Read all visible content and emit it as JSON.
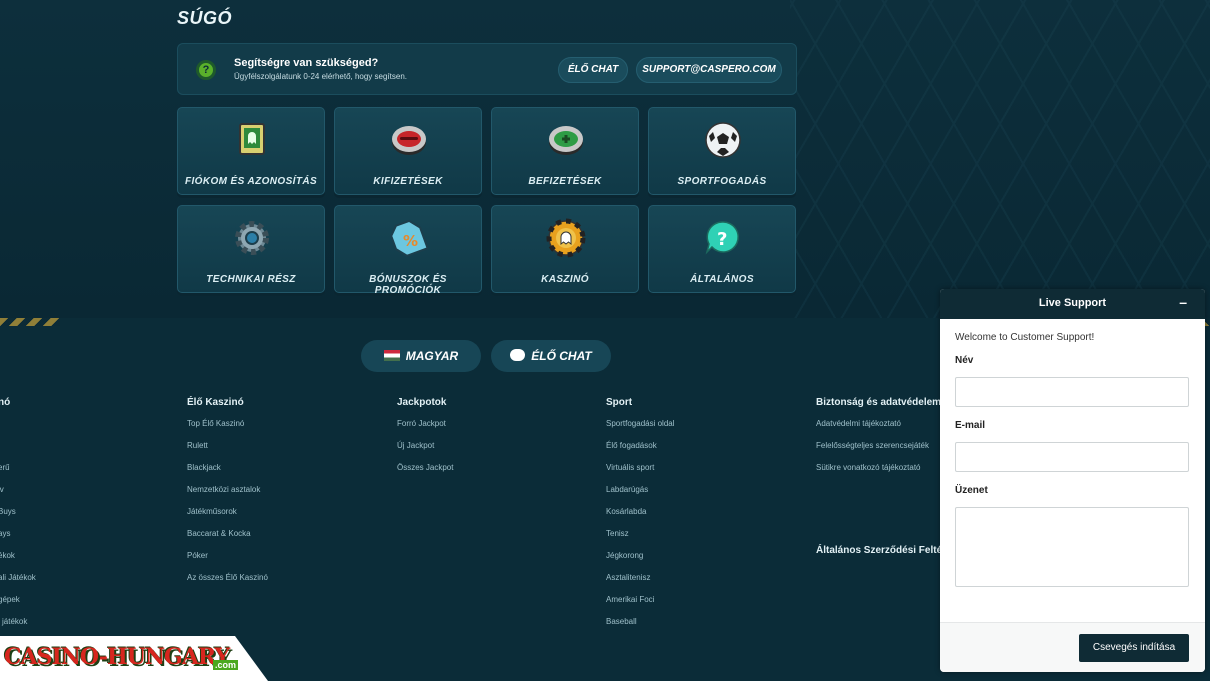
{
  "help": {
    "title": "SÚGÓ",
    "bar_title": "Segítségre van szükséged?",
    "bar_subtitle": "Ügyfélszolgálatunk 0-24 elérhető, hogy segítsen.",
    "question_mark": "?",
    "live_chat_label": "ÉLŐ CHAT",
    "email_label": "SUPPORT@CASPERO.COM"
  },
  "tiles": [
    {
      "label": "FIÓKOM ÉS AZONOSÍTÁS",
      "icon": "ghost-card-icon"
    },
    {
      "label": "KIFIZETÉSEK",
      "icon": "red-chip-icon"
    },
    {
      "label": "BEFIZETÉSEK",
      "icon": "green-chip-icon"
    },
    {
      "label": "SPORTFOGADÁS",
      "icon": "soccer-ball-icon"
    },
    {
      "label": "TECHNIKAI RÉSZ",
      "icon": "gear-icon"
    },
    {
      "label": "BÓNUSZOK ÉS PROMÓCIÓK",
      "icon": "percent-tag-icon"
    },
    {
      "label": "KASZINÓ",
      "icon": "casino-chip-icon"
    },
    {
      "label": "ÁLTALÁNOS",
      "icon": "question-bubble-icon"
    }
  ],
  "footer": {
    "language_label": "MAGYAR",
    "live_chat_label": "ÉLŐ CHAT",
    "columns": [
      {
        "title": "nó",
        "items": [
          "",
          "",
          "erű",
          "iv",
          "Buys",
          "ays",
          "ékok",
          "ali Játékok",
          "gépek",
          "i játékok"
        ]
      },
      {
        "title": "Élő Kaszinó",
        "items": [
          "Top Élő Kaszinó",
          "Rulett",
          "Blackjack",
          "Nemzetközi asztalok",
          "Játékműsorok",
          "Baccarat & Kocka",
          "Póker",
          "Az összes Élő Kaszinó"
        ]
      },
      {
        "title": "Jackpotok",
        "items": [
          "Forró Jackpot",
          "Új Jackpot",
          "Összes Jackpot"
        ]
      },
      {
        "title": "Sport",
        "items": [
          "Sportfogadási oldal",
          "Élő fogadások",
          "Virtuális sport",
          "Labdarúgás",
          "Kosárlabda",
          "Tenisz",
          "Jégkorong",
          "Asztalitenisz",
          "Amerikai Foci",
          "Baseball"
        ]
      },
      {
        "title": "Biztonság és adatvédelem",
        "items": [
          "Adatvédelmi tájékoztató",
          "Felelősségteljes szerencsejáték",
          "Sütikre vonatkozó tájékoztató"
        ]
      }
    ],
    "terms_heading": "Általános Szerződési Feltételek"
  },
  "support": {
    "title": "Live Support",
    "minimize": "–",
    "welcome": "Welcome to Customer Support!",
    "name_label": "Név",
    "email_label": "E-mail",
    "message_label": "Üzenet",
    "send_label": "Csevegés indítása"
  },
  "logo": {
    "text": "CASINO-HUNGARY",
    "suffix": ".com"
  },
  "colors": {
    "accent_green": "#5ab12b",
    "dark_teal": "#0b2a36",
    "tile": "#174655"
  }
}
